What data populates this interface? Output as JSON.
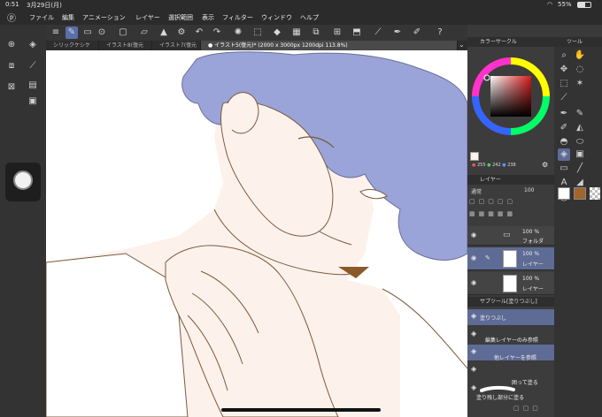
{
  "status": {
    "time": "0:51",
    "date": "3月29日(月)",
    "battery": "55%"
  },
  "menu": [
    "ファイル",
    "編集",
    "アニメーション",
    "レイヤー",
    "選択範囲",
    "表示",
    "フィルター",
    "ウィンドウ",
    "ヘルプ"
  ],
  "tabs": [
    {
      "label": "シリックケシケ"
    },
    {
      "label": "イラスト8(復元"
    },
    {
      "label": "イラスト7(復元"
    },
    {
      "label": "● イラスト5(復元)* (2000 x 3000px 1200dpi 113.8%)"
    }
  ],
  "color_panel": {
    "title": "カラーサークル",
    "rgb": {
      "r": "255",
      "g": "242",
      "b": "238"
    },
    "main_color": "#fff2ee",
    "hue_color": "#d81b1b"
  },
  "layer_panel": {
    "title": "レイヤー",
    "blend_mode": "通常",
    "opacity": "100",
    "layers": [
      {
        "opacity": "100 %",
        "name": "フォルダ"
      },
      {
        "opacity": "100 %",
        "name": "レイヤー"
      },
      {
        "opacity": "100 %",
        "name": "レイヤー"
      }
    ]
  },
  "subtool_panel": {
    "title": "サブツール[塗りつぶし]",
    "items": [
      {
        "label": "塗りつぶし"
      },
      {
        "label": "編集レイヤーのみ参照"
      },
      {
        "label": "他レイヤーを参照"
      },
      {
        "label": ""
      },
      {
        "label": "囲って塗る"
      },
      {
        "label": "塗り残し部分に塗る"
      }
    ]
  },
  "tool_panel": {
    "title": "ツール",
    "swatch_colors": [
      "#ffffff",
      "#a0652a"
    ]
  },
  "colors": {
    "hair": "#9aa4d8",
    "skin": "#fdf1ec",
    "line": "#7a5a3a",
    "accent_selected": "#5d6b95"
  }
}
